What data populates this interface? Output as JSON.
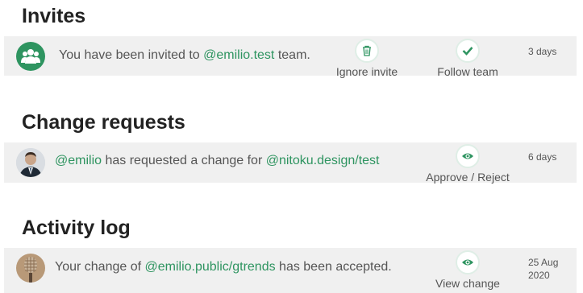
{
  "invites": {
    "title": "Invites",
    "message_prefix": "You have been invited to ",
    "team_link": "@emilio.test",
    "message_suffix": " team.",
    "ignore_label": "Ignore invite",
    "follow_label": "Follow team",
    "time": "3 days"
  },
  "change_requests": {
    "title": "Change requests",
    "user_link": "@emilio",
    "message_mid": " has requested a change for ",
    "target_link": "@nitoku.design/test",
    "action_label": "Approve / Reject",
    "time": "6 days"
  },
  "activity_log": {
    "title": "Activity log",
    "message_prefix": "Your change of ",
    "target_link": "@emilio.public/gtrends",
    "message_suffix": " has been accepted.",
    "action_label": "View change",
    "time_line1": "25 Aug",
    "time_line2": "2020"
  },
  "colors": {
    "accent": "#2e9460",
    "row_bg": "#f0f0f0",
    "title": "#222222"
  },
  "icons": [
    "team-icon",
    "trash-icon",
    "check-icon",
    "eye-icon"
  ]
}
